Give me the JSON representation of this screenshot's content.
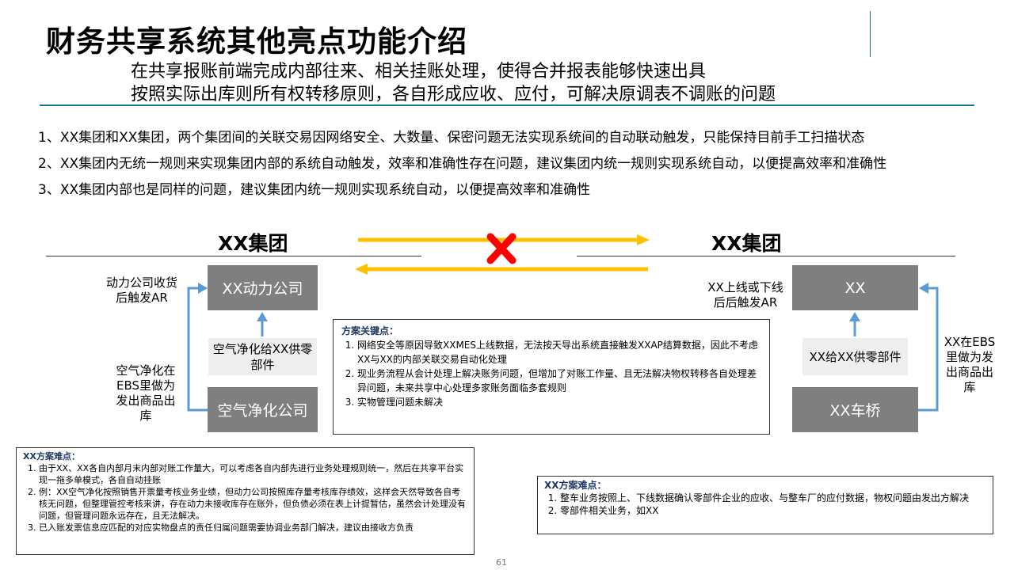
{
  "header": {
    "title": "财务共享系统其他亮点功能介绍",
    "subtitle_1": "在共享报账前端完成内部往来、相关挂账处理，使得合并报表能够快速出具",
    "subtitle_2": "按照实际出库则所有权转移原则，各自形成应收、应付，可解决原调表不调账的问题"
  },
  "points": [
    "1、XX集团和XX集团，两个集团间的关联交易因网络安全、大数量、保密问题无法实现系统间的自动联动触发，只能保持目前手工扫描状态",
    "2、XX集团内无统一规则来实现集团内部的系统自动触发，效率和准确性存在问题，建议集团内统一规则实现系统自动，以便提高效率和准确性",
    "3、XX集团内部也是同样的问题，建议集团内统一规则实现系统自动，以便提高效率和准确性"
  ],
  "diagram": {
    "left_group": "XX集团",
    "right_group": "XX集团",
    "left_top_box": "XX动力公司",
    "left_bottom_box": "空气净化公司",
    "left_mid_label": "空气净化给XX供零部件",
    "left_top_note": "动力公司收货后触发AR",
    "left_bottom_note": "空气净化在EBS里做为发出商品出库",
    "right_top_box": "XX",
    "right_bottom_box": "XX车桥",
    "right_mid_label": "XX给XX供零部件",
    "right_top_note": "XX上线或下线后后触发AR",
    "right_side_note": "XX在EBS里做为发出商品出库",
    "colors": {
      "arrow_yellow": "#FFC000",
      "arrow_blue": "#5B9BD5",
      "cross_red": "#FF0000",
      "box_gray": "#7F7F7F",
      "label_bg": "#EEEEEE"
    }
  },
  "key_points": {
    "heading": "方案关键点：",
    "items": [
      "网络安全等原因导致XXMES上线数据，无法按天导出系统直接触发XXAP结算数据，因此不考虑XX与XX的内部关联交易自动化处理",
      "现业务流程从会计处理上解决账务问题，但增加了对账工作量、且无法解决物权转移各自处理差异问题，未来共享中心处理多家账务面临多套规则",
      "实物管理问题未解决"
    ]
  },
  "difficulty_left": {
    "heading": "XX方案难点：",
    "items": [
      "由于XX、XX各自内部月末内部对账工作量大，可以考虑各自内部先进行业务处理规则统一，然后在共享平台实现一拖多单模式，各自自动挂账",
      "例：XX空气净化按照销售开票量考核业务业绩，但动力公司按照库存量考核库存绩效，这样会天然导致各自考核无问题，但整理管控考核来讲，存在动力未接收库存在账外，但负债必须在表上计提暂估，虽然会计处理没有问题，但管理问题永远存在，且无法解决。",
      "已入账发票信息应匹配的对应实物盘点的责任归属问题需要协调业务部门解决，建议由接收方负责"
    ]
  },
  "difficulty_right": {
    "heading": "XX方案难点：",
    "items": [
      "整车业务按照上、下线数据确认零部件企业的应收、与整车厂的应付数据，物权问题由发出方解决",
      "零部件相关业务，如XX"
    ]
  },
  "page_number": "61"
}
